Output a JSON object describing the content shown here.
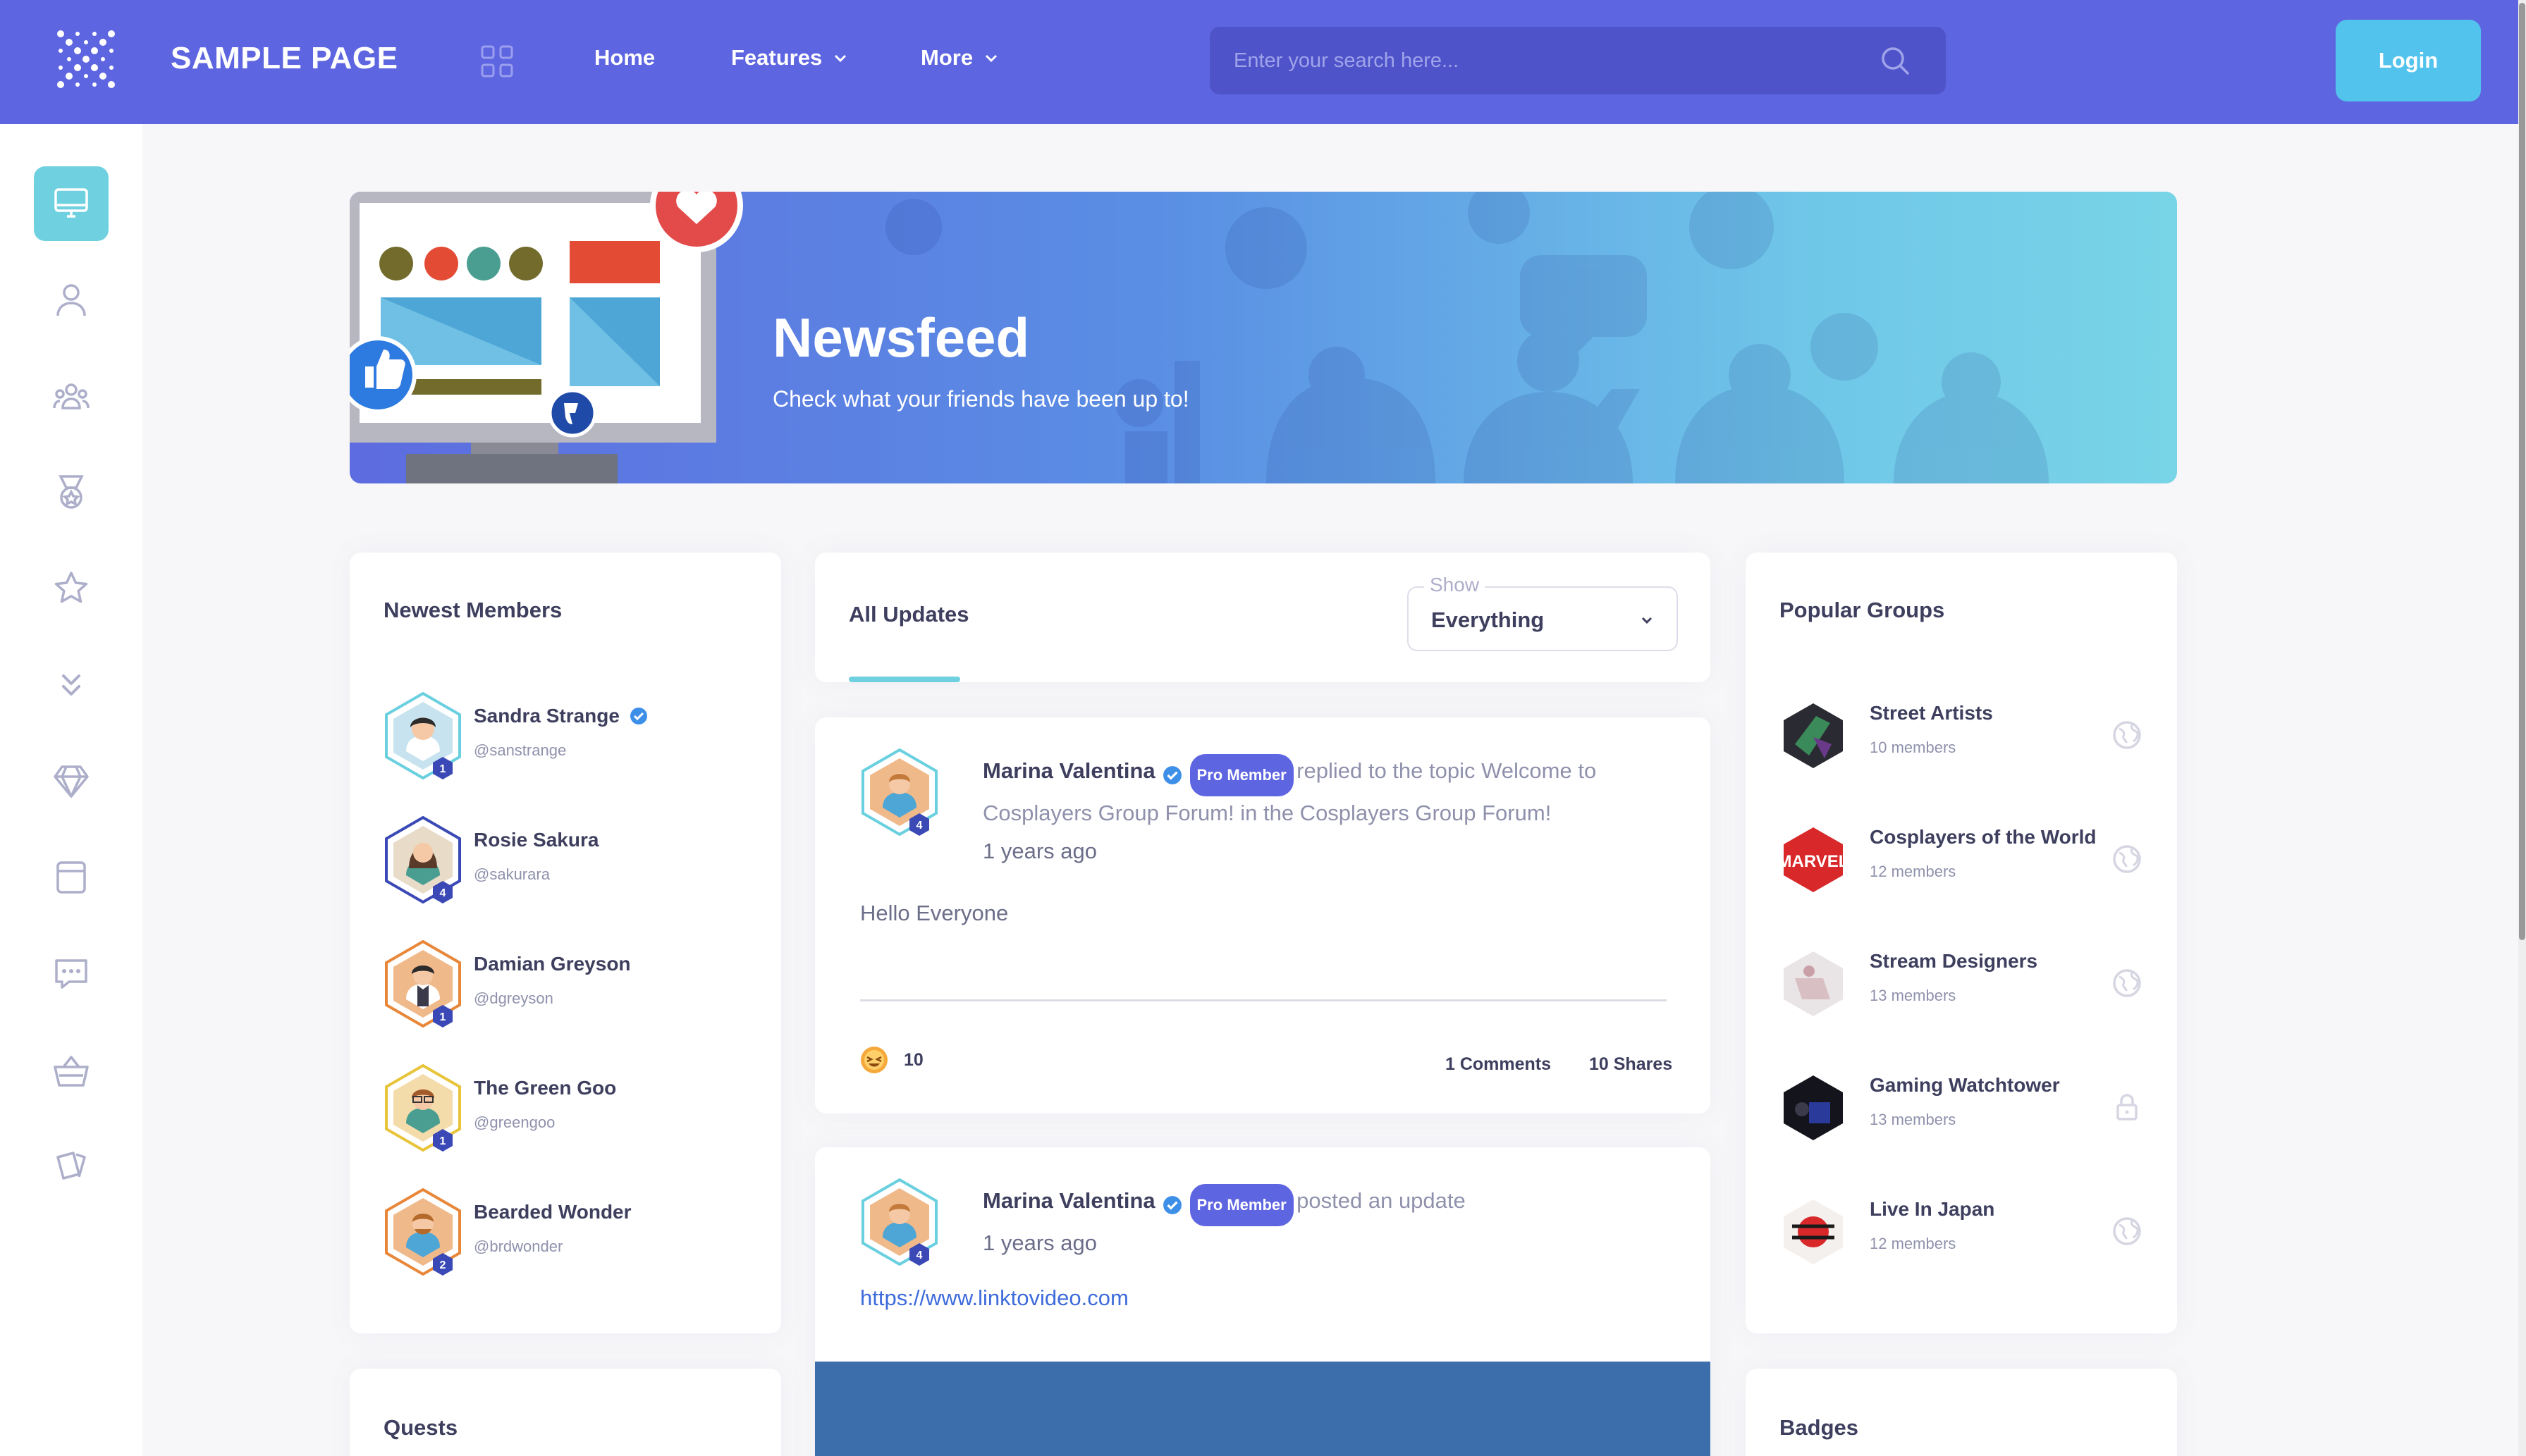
{
  "header": {
    "brand": "SAMPLE PAGE",
    "nav": [
      {
        "label": "Home"
      },
      {
        "label": "Features"
      },
      {
        "label": "More"
      }
    ],
    "search_placeholder": "Enter your search here...",
    "login_label": "Login"
  },
  "banner": {
    "title": "Newsfeed",
    "subtitle": "Check what your friends have been up to!"
  },
  "newest_members": {
    "title": "Newest Members",
    "members": [
      {
        "name": "Sandra Strange",
        "handle": "@sanstrange",
        "level": "1",
        "verified": true
      },
      {
        "name": "Rosie Sakura",
        "handle": "@sakurara",
        "level": "4",
        "verified": false
      },
      {
        "name": "Damian Greyson",
        "handle": "@dgreyson",
        "level": "1",
        "verified": false
      },
      {
        "name": "The Green Goo",
        "handle": "@greengoo",
        "level": "1",
        "verified": false
      },
      {
        "name": "Bearded Wonder",
        "handle": "@brdwonder",
        "level": "2",
        "verified": false
      }
    ]
  },
  "quests": {
    "title": "Quests"
  },
  "feed": {
    "tab_label": "All Updates",
    "filter_label": "Show",
    "filter_value": "Everything",
    "posts": [
      {
        "author": "Marina Valentina",
        "badge": "Pro Member",
        "level": "4",
        "action_line1": "replied to the topic Welcome to",
        "action_line2": "Cosplayers Group Forum! in the Cosplayers Group Forum!",
        "time": "1 years ago",
        "body": "Hello Everyone",
        "reactions": "10",
        "comments": "1 Comments",
        "shares": "10 Shares"
      },
      {
        "author": "Marina Valentina",
        "badge": "Pro Member",
        "level": "4",
        "action_line1": "posted an update",
        "time": "1 years ago",
        "link": "https://www.linktovideo.com"
      }
    ]
  },
  "popular_groups": {
    "title": "Popular Groups",
    "groups": [
      {
        "name": "Street Artists",
        "members": "10 members",
        "visibility": "globe-icon"
      },
      {
        "name": "Cosplayers of the World",
        "members": "12 members",
        "visibility": "globe-icon",
        "logo_text": "MARVEL"
      },
      {
        "name": "Stream Designers",
        "members": "13 members",
        "visibility": "globe-icon"
      },
      {
        "name": "Gaming Watchtower",
        "members": "13 members",
        "visibility": "lock-icon"
      },
      {
        "name": "Live In Japan",
        "members": "12 members",
        "visibility": "globe-icon"
      }
    ]
  },
  "badges": {
    "title": "Badges"
  },
  "colors": {
    "header": "#5e65e0",
    "accent": "#6fd0df",
    "login": "#52c3ec",
    "text": "#3e3f5e",
    "muted": "#8f91ac"
  }
}
